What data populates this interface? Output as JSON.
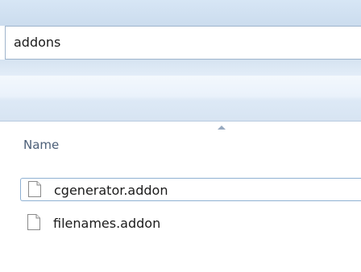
{
  "address": {
    "path": "addons"
  },
  "columns": [
    {
      "label": "Name",
      "sorted": "ascending"
    }
  ],
  "files": [
    {
      "name": "cgenerator.addon",
      "selected": true
    },
    {
      "name": "filenames.addon",
      "selected": false
    }
  ]
}
